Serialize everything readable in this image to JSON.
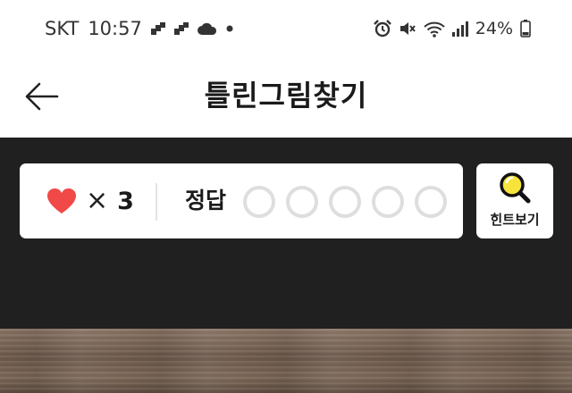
{
  "status_bar": {
    "carrier": "SKT",
    "time": "10:57",
    "battery": "24%",
    "left_icons": [
      "notification-icon",
      "notification-icon",
      "cloud-icon",
      "dot-icon"
    ],
    "right_icons": [
      "alarm-icon",
      "mute-icon",
      "wifi-icon",
      "signal-icon",
      "battery-icon"
    ]
  },
  "header": {
    "title": "틀린그림찾기",
    "back_icon": "arrow-left-icon"
  },
  "game_panel": {
    "lives_icon": "heart-icon",
    "lives_multiplier": "×",
    "lives_count": "3",
    "answer_label": "정답",
    "answer_slots_total": 5,
    "answer_slots_found": 0,
    "hint_label": "힌트보기",
    "hint_icon": "magnifier-icon"
  },
  "colors": {
    "heart": "#f14848",
    "game_bg": "#202020",
    "slot_border": "#dedede",
    "hint_lens": "#f6e33c"
  }
}
